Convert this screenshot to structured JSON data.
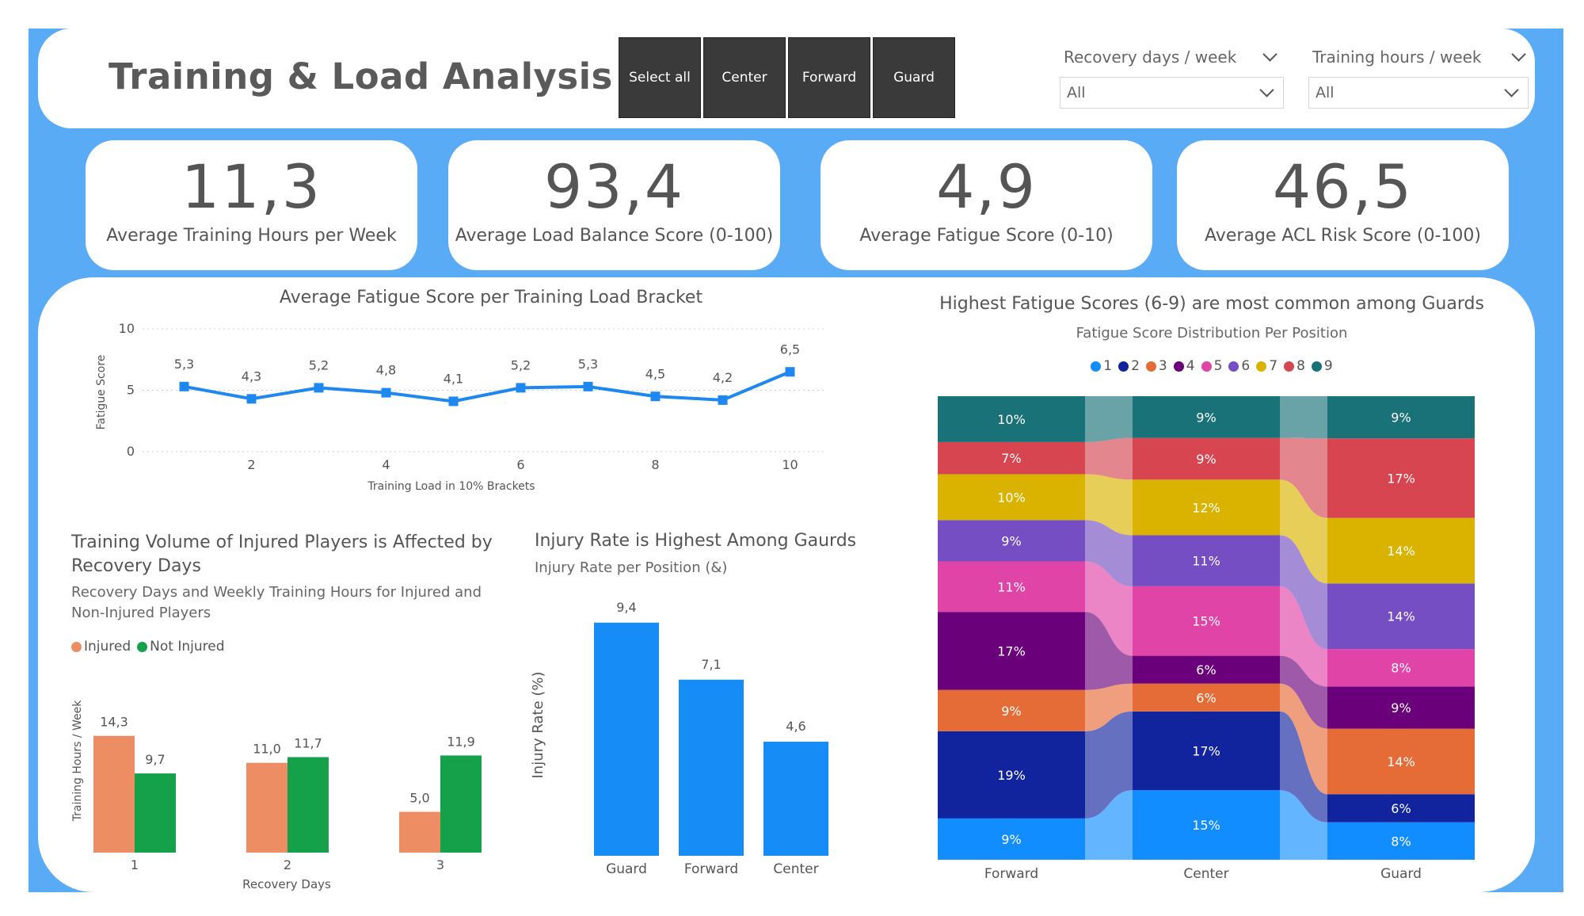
{
  "title": "Training & Load Analysis",
  "slicer": {
    "buttons": [
      "Select all",
      "Center",
      "Forward",
      "Guard"
    ]
  },
  "filters": [
    {
      "label": "Recovery days / week",
      "value": "All"
    },
    {
      "label": "Training hours / week",
      "value": "All"
    }
  ],
  "kpis": [
    {
      "value": "11,3",
      "label": "Average Training Hours per Week"
    },
    {
      "value": "93,4",
      "label": "Average Load Balance Score (0-100)"
    },
    {
      "value": "4,9",
      "label": "Average Fatigue Score (0-10)"
    },
    {
      "value": "46,5",
      "label": "Average ACL Risk Score (0-100)"
    }
  ],
  "colors": {
    "frame": "#5aabf5",
    "line": "#1e88f0",
    "injured": "#ed8d63",
    "not_injured": "#14a14a",
    "bar": "#158cf6",
    "fatigue": {
      "1": "#118dff",
      "2": "#12239e",
      "3": "#e66c37",
      "4": "#6b007b",
      "5": "#e044a7",
      "6": "#744ec2",
      "7": "#d9b300",
      "8": "#d64550",
      "9": "#197278"
    }
  },
  "chart_data": [
    {
      "type": "line",
      "title": "Average Fatigue Score per Training Load Bracket",
      "xlabel": "Training Load in 10% Brackets",
      "ylabel": "Fatigue Score",
      "x": [
        1,
        2,
        3,
        4,
        5,
        6,
        7,
        8,
        9,
        10
      ],
      "y": [
        5.3,
        4.3,
        5.2,
        4.8,
        4.1,
        5.2,
        5.3,
        4.5,
        4.2,
        6.5
      ],
      "labels": [
        "5,3",
        "4,3",
        "5,2",
        "4,8",
        "4,1",
        "5,2",
        "5,3",
        "4,5",
        "4,2",
        "6,5"
      ],
      "ylim": [
        0,
        10
      ],
      "yticks": [
        "0",
        "5",
        "10"
      ],
      "xticks": [
        2,
        4,
        6,
        8,
        10
      ],
      "xtick_labels": [
        "2",
        "4",
        "6",
        "8",
        "10"
      ],
      "grid": true
    },
    {
      "type": "bar",
      "title": "Training Volume of Injured Players is Affected by Recovery Days",
      "subtitle": "Recovery Days and Weekly Training Hours for Injured and Non-Injured Players",
      "xlabel": "Recovery Days",
      "ylabel": "Training Hours / Week",
      "categories": [
        "1",
        "2",
        "3"
      ],
      "series": [
        {
          "name": "Injured",
          "values": [
            14.3,
            11.0,
            5.0
          ],
          "labels": [
            "14,3",
            "11,0",
            "5,0"
          ]
        },
        {
          "name": "Not Injured",
          "values": [
            9.7,
            11.7,
            11.9
          ],
          "labels": [
            "9,7",
            "11,7",
            "11,9"
          ]
        }
      ],
      "legend": "top-left"
    },
    {
      "type": "bar",
      "title": "Injury Rate is Highest Among Gaurds",
      "subtitle": "Injury Rate per Position (&)",
      "ylabel": "Injury Rate (%)",
      "categories": [
        "Guard",
        "Forward",
        "Center"
      ],
      "values": [
        9.4,
        7.1,
        4.6
      ],
      "labels": [
        "9,4",
        "7,1",
        "4,6"
      ]
    },
    {
      "type": "bar",
      "stacked": "100%",
      "title": "Highest Fatigue Scores (6-9) are most common among Guards",
      "subtitle": "Fatigue Score Distribution Per Position",
      "categories": [
        "Forward",
        "Center",
        "Guard"
      ],
      "legend": "top-center",
      "series": [
        {
          "name": "1",
          "values": [
            9,
            15,
            8
          ],
          "labels": [
            "9%",
            "15%",
            "8%"
          ]
        },
        {
          "name": "2",
          "values": [
            19,
            17,
            6
          ],
          "labels": [
            "19%",
            "17%",
            "6%"
          ]
        },
        {
          "name": "3",
          "values": [
            9,
            6,
            14
          ],
          "labels": [
            "9%",
            "6%",
            "14%"
          ]
        },
        {
          "name": "4",
          "values": [
            17,
            6,
            9
          ],
          "labels": [
            "17%",
            "6%",
            "9%"
          ]
        },
        {
          "name": "5",
          "values": [
            11,
            15,
            8
          ],
          "labels": [
            "11%",
            "15%",
            "8%"
          ]
        },
        {
          "name": "6",
          "values": [
            9,
            11,
            14
          ],
          "labels": [
            "9%",
            "11%",
            "14%"
          ]
        },
        {
          "name": "7",
          "values": [
            10,
            12,
            14
          ],
          "labels": [
            "10%",
            "12%",
            "14%"
          ]
        },
        {
          "name": "8",
          "values": [
            7,
            9,
            17
          ],
          "labels": [
            "7%",
            "9%",
            "17%"
          ]
        },
        {
          "name": "9",
          "values": [
            10,
            9,
            9
          ],
          "labels": [
            "10%",
            "9%",
            "9%"
          ]
        }
      ]
    }
  ]
}
